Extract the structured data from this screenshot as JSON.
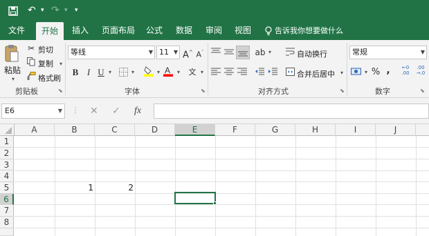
{
  "quick_access": {
    "save_icon": "save-icon",
    "undo_icon": "undo-icon",
    "redo_icon": "redo-icon",
    "customize_icon": "customize-icon"
  },
  "tabs": [
    "文件",
    "开始",
    "插入",
    "页面布局",
    "公式",
    "数据",
    "审阅",
    "视图"
  ],
  "active_tab": "开始",
  "tell_me": "告诉我你想要做什么",
  "ribbon": {
    "clipboard": {
      "paste": "粘贴",
      "cut": "剪切",
      "copy": "复制",
      "format_painter": "格式刷",
      "label": "剪贴板"
    },
    "font": {
      "name": "等线",
      "size": "11",
      "bold": "B",
      "italic": "I",
      "underline": "U",
      "grow": "A",
      "shrink": "A",
      "label": "字体",
      "highlight_color": "#ffff00",
      "font_color": "#ff0000"
    },
    "alignment": {
      "wrap": "自动换行",
      "merge": "合并后居中",
      "label": "对齐方式"
    },
    "number": {
      "format": "常规",
      "percent": "%",
      "comma": ",",
      "label": "数字"
    }
  },
  "formula_bar": {
    "name_box": "E6",
    "cancel": "✕",
    "enter": "✓",
    "fx": "fx",
    "value": ""
  },
  "columns": [
    "A",
    "B",
    "C",
    "D",
    "E",
    "F",
    "G",
    "H",
    "I",
    "J"
  ],
  "rows": [
    "1",
    "2",
    "3",
    "4",
    "5",
    "6",
    "7",
    "8"
  ],
  "selected_column": "E",
  "selected_row": "6",
  "cells": {
    "B5": "1",
    "C5": "2"
  },
  "accent_color": "#217346"
}
